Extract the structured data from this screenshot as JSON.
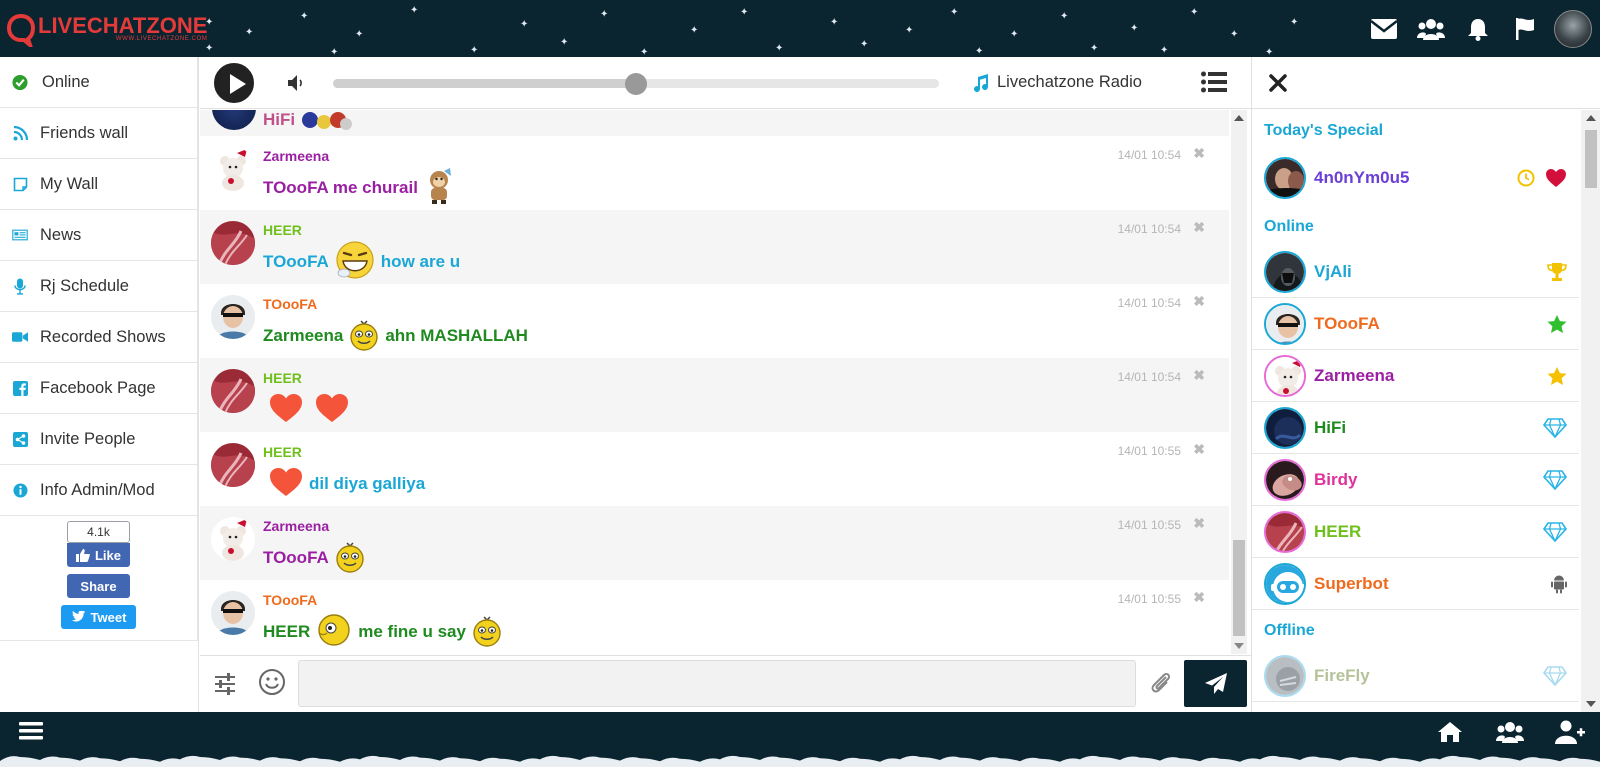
{
  "header": {
    "logo_title": "LIVECHATZONE",
    "logo_sub": "WWW.LIVECHATZONE.COM",
    "icons": [
      "mail-icon",
      "friends-icon",
      "bell-icon",
      "flag-icon"
    ]
  },
  "sidebar": {
    "items": [
      {
        "label": "Online",
        "icon": "online-status-icon",
        "color": "#2e9e2e"
      },
      {
        "label": "Friends wall",
        "icon": "rss-icon",
        "color": "#1aa7d6"
      },
      {
        "label": "My Wall",
        "icon": "note-icon",
        "color": "#1aa7d6"
      },
      {
        "label": "News",
        "icon": "newspaper-icon",
        "color": "#1aa7d6"
      },
      {
        "label": "Rj Schedule",
        "icon": "microphone-icon",
        "color": "#1aa7d6"
      },
      {
        "label": "Recorded Shows",
        "icon": "video-camera-icon",
        "color": "#1aa7d6"
      },
      {
        "label": "Facebook Page",
        "icon": "facebook-icon",
        "color": "#1aa7d6"
      },
      {
        "label": "Invite People",
        "icon": "share-icon",
        "color": "#1aa7d6"
      },
      {
        "label": "Info Admin/Mod",
        "icon": "info-icon",
        "color": "#1aa7d6"
      }
    ],
    "social": {
      "like_count": "4.1k",
      "like_label": "Like",
      "share_label": "Share",
      "tweet_label": "Tweet"
    }
  },
  "player": {
    "radio_name": "Livechatzone Radio",
    "volume_level": 0.5
  },
  "messages": {
    "partial_top": {
      "text": "HiFi",
      "color": "#c0508a"
    },
    "items": [
      {
        "user": "Zarmeena",
        "user_color": "#9b1fa3",
        "time": "14/01 10:54",
        "alt": false,
        "avatar": "teddy",
        "parts": [
          {
            "t": "text",
            "v": "TOooFA me churail",
            "c": "#9b1fa3"
          },
          {
            "t": "emo",
            "v": "monkey"
          }
        ]
      },
      {
        "user": "HEER",
        "user_color": "#6fbf1d",
        "time": "14/01 10:54",
        "alt": true,
        "avatar": "heer",
        "parts": [
          {
            "t": "text",
            "v": "TOooFA",
            "c": "#1aa7d6"
          },
          {
            "t": "emo",
            "v": "laugh"
          },
          {
            "t": "text",
            "v": "how are u",
            "c": "#1aa7d6"
          }
        ]
      },
      {
        "user": "TOooFA",
        "user_color": "#f06a1e",
        "time": "14/01 10:54",
        "alt": false,
        "avatar": "man",
        "parts": [
          {
            "t": "text",
            "v": "Zarmeena",
            "c": "#1f8a1f"
          },
          {
            "t": "emo",
            "v": "smiley"
          },
          {
            "t": "text",
            "v": "ahn MASHALLAH",
            "c": "#1f8a1f"
          }
        ]
      },
      {
        "user": "HEER",
        "user_color": "#6fbf1d",
        "time": "14/01 10:54",
        "alt": true,
        "avatar": "heer",
        "parts": [
          {
            "t": "emo",
            "v": "heart"
          },
          {
            "t": "emo",
            "v": "heart"
          }
        ]
      },
      {
        "user": "HEER",
        "user_color": "#6fbf1d",
        "time": "14/01 10:55",
        "alt": false,
        "avatar": "heer",
        "parts": [
          {
            "t": "emo",
            "v": "heart"
          },
          {
            "t": "text",
            "v": "dil diya galliya",
            "c": "#1aa7d6"
          }
        ]
      },
      {
        "user": "Zarmeena",
        "user_color": "#9b1fa3",
        "time": "14/01 10:55",
        "alt": true,
        "avatar": "teddy",
        "parts": [
          {
            "t": "text",
            "v": "TOooFA",
            "c": "#9b1fa3"
          },
          {
            "t": "emo",
            "v": "smiley"
          }
        ]
      },
      {
        "user": "TOooFA",
        "user_color": "#f06a1e",
        "time": "14/01 10:55",
        "alt": false,
        "avatar": "man",
        "parts": [
          {
            "t": "text",
            "v": "HEER",
            "c": "#1f8a1f"
          },
          {
            "t": "emo",
            "v": "side"
          },
          {
            "t": "text",
            "v": "me fine u say",
            "c": "#1f8a1f"
          },
          {
            "t": "emo",
            "v": "smiley"
          }
        ]
      }
    ]
  },
  "composer": {
    "placeholder": ""
  },
  "userlist": {
    "sections": [
      {
        "title": "Today's Special",
        "users": [
          {
            "name": "4n0nYm0u5",
            "color": "#6b3fd6",
            "ring": "#1aa7d6",
            "avatar": "dark",
            "badges": [
              "clock-icon",
              "heart-icon"
            ]
          }
        ]
      },
      {
        "title": "Online",
        "users": [
          {
            "name": "VjAli",
            "color": "#1aa7d6",
            "ring": "#1aa7d6",
            "avatar": "hood",
            "badges": [
              "trophy-icon"
            ]
          },
          {
            "name": "TOooFA",
            "color": "#f06a1e",
            "ring": "#1aa7d6",
            "avatar": "man",
            "badges": [
              "star-green-icon"
            ]
          },
          {
            "name": "Zarmeena",
            "color": "#9b1fa3",
            "ring": "#e66bd6",
            "avatar": "teddy",
            "badges": [
              "star-gold-icon"
            ]
          },
          {
            "name": "HiFi",
            "color": "#1f8a1f",
            "ring": "#1aa7d6",
            "avatar": "navy",
            "badges": [
              "diamond-icon"
            ]
          },
          {
            "name": "Birdy",
            "color": "#e0309a",
            "ring": "#e66bd6",
            "avatar": "hands",
            "badges": [
              "diamond-icon"
            ]
          },
          {
            "name": "HEER",
            "color": "#6fbf1d",
            "ring": "#e66bd6",
            "avatar": "heer",
            "badges": [
              "diamond-icon"
            ]
          },
          {
            "name": "Superbot",
            "color": "#f06a1e",
            "ring": "#1aa7d6",
            "avatar": "bot",
            "badges": [
              "android-icon"
            ]
          }
        ]
      },
      {
        "title": "Offline",
        "users": [
          {
            "name": "FireFly",
            "color": "#b5c29a",
            "ring": "#a8dbef",
            "avatar": "grey",
            "badges": [
              "diamond-faded-icon"
            ]
          }
        ]
      }
    ]
  },
  "footer": {
    "icons": [
      "home-icon",
      "friends-icon",
      "add-friend-icon"
    ]
  }
}
